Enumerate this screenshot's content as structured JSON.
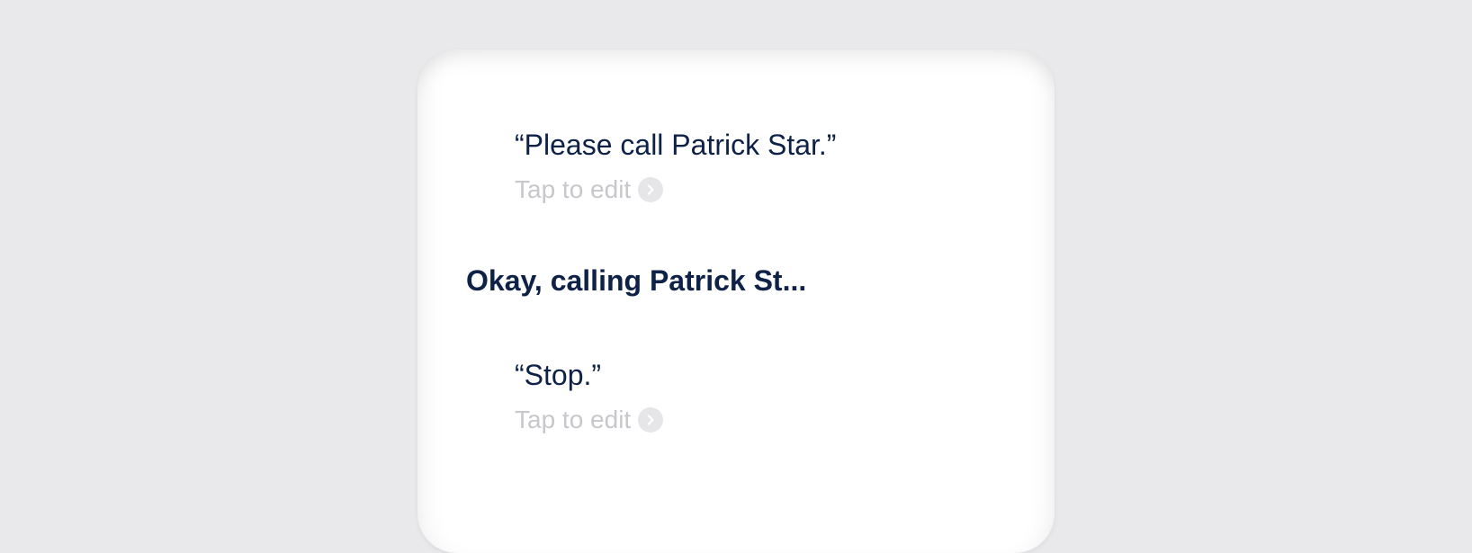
{
  "conversation": {
    "first_query": {
      "text": "“Please call Patrick Star.”",
      "edit_label": "Tap to edit",
      "edit_icon": "chevron-right-icon"
    },
    "response": {
      "text": "Okay, calling Patrick St..."
    },
    "second_query": {
      "text": "“Stop.”",
      "edit_label": "Tap to edit",
      "edit_icon": "chevron-right-icon"
    }
  },
  "colors": {
    "background": "#e9e9eb",
    "card": "#ffffff",
    "primary_text": "#0e2146",
    "muted_text": "#c7c7cc",
    "icon_fill": "#e6e6e8"
  }
}
